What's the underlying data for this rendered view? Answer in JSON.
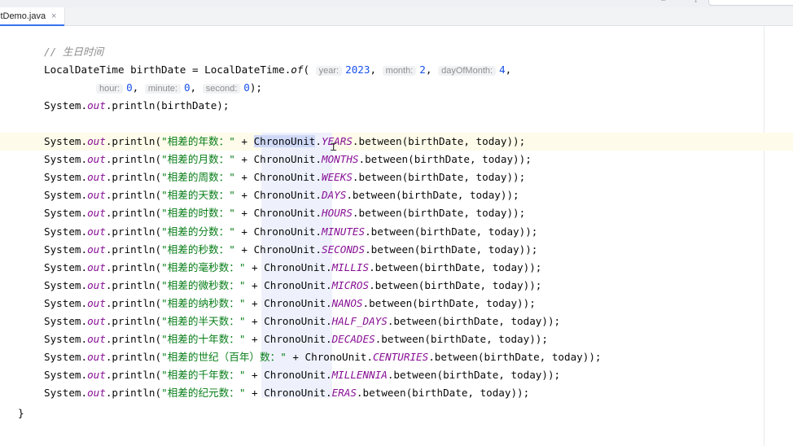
{
  "tab": {
    "label": "itDemo.java",
    "close": "×"
  },
  "code": {
    "comment": "// 生日时间",
    "decl_a": "LocalDateTime birthDate = LocalDateTime.",
    "decl_fn": "of",
    "decl_paren": "(",
    "hint_year": "year:",
    "val_year": "2023",
    "hint_month": "month:",
    "val_month": "2",
    "hint_day": "dayOfMonth:",
    "val_day": "4",
    "comma": ",",
    "hint_hour": "hour:",
    "val_hour": "0",
    "hint_minute": "minute:",
    "val_minute": "0",
    "hint_second": "second:",
    "val_second": "0",
    "decl_end": ");",
    "sys": "System.",
    "out": "out",
    "println_open": ".println(",
    "println_birth": ".println(birthDate);",
    "plus": " + ",
    "chrono": "ChronoUnit",
    "dot": ".",
    "between_tail": ".between(birthDate, today));",
    "closing_brace": "}",
    "rows": [
      {
        "label": "\"相差的年数：\"",
        "unit": "YEARS"
      },
      {
        "label": "\"相差的月数：\"",
        "unit": "MONTHS"
      },
      {
        "label": "\"相差的周数：\"",
        "unit": "WEEKS"
      },
      {
        "label": "\"相差的天数：\"",
        "unit": "DAYS"
      },
      {
        "label": "\"相差的时数：\"",
        "unit": "HOURS"
      },
      {
        "label": "\"相差的分数：\"",
        "unit": "MINUTES"
      },
      {
        "label": "\"相差的秒数：\"",
        "unit": "SECONDS"
      },
      {
        "label": "\"相差的毫秒数：\"",
        "unit": "MILLIS"
      },
      {
        "label": "\"相差的微秒数：\"",
        "unit": "MICROS"
      },
      {
        "label": "\"相差的纳秒数：\"",
        "unit": "NANOS"
      },
      {
        "label": "\"相差的半天数：\"",
        "unit": "HALF_DAYS"
      },
      {
        "label": "\"相差的十年数：\"",
        "unit": "DECADES"
      },
      {
        "label": "\"相差的世纪（百年）数：\"",
        "unit": "CENTURIES"
      },
      {
        "label": "\"相差的千年数：\"",
        "unit": "MILLENNIA"
      },
      {
        "label": "\"相差的纪元数：\"",
        "unit": "ERAS"
      }
    ]
  }
}
